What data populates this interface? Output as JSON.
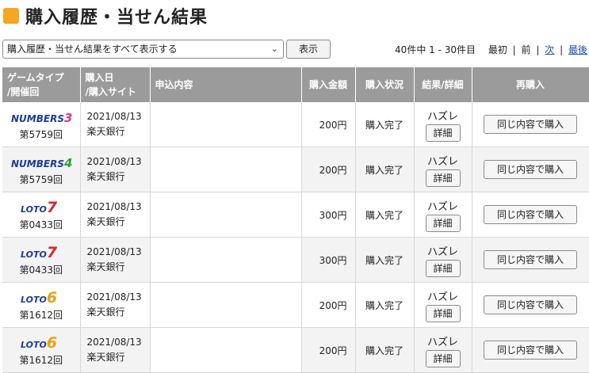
{
  "page": {
    "title": "購入履歴・当せん結果",
    "accent_color": "#f5a623"
  },
  "controls": {
    "filter_value": "購入履歴・当せん結果をすべて表示する",
    "show_label": "表示"
  },
  "pager": {
    "summary": "40件中 1 - 30件目",
    "first": "最初",
    "prev": "前",
    "next": "次",
    "last": "最後",
    "separator": "|"
  },
  "table": {
    "headers": {
      "game": "ゲームタイプ /開催回",
      "date": "購入日 /購入サイト",
      "content": "申込内容",
      "amount": "購入金額",
      "status": "購入状況",
      "result": "結果/詳細",
      "rebuy": "再購入"
    },
    "rows": [
      {
        "game": "NUMBERS3",
        "logo": "numbers3-logo",
        "round": "第5759回",
        "date": "2021/08/13",
        "site": "楽天銀行",
        "amount": "200円",
        "status": "購入完了",
        "result": "ハズレ",
        "detail": "詳細",
        "rebuy": "同じ内容で購入"
      },
      {
        "game": "NUMBERS4",
        "logo": "numbers4-logo",
        "round": "第5759回",
        "date": "2021/08/13",
        "site": "楽天銀行",
        "amount": "200円",
        "status": "購入完了",
        "result": "ハズレ",
        "detail": "詳細",
        "rebuy": "同じ内容で購入"
      },
      {
        "game": "LOTO7",
        "logo": "loto7-logo",
        "round": "第0433回",
        "date": "2021/08/13",
        "site": "楽天銀行",
        "amount": "300円",
        "status": "購入完了",
        "result": "ハズレ",
        "detail": "詳細",
        "rebuy": "同じ内容で購入"
      },
      {
        "game": "LOTO7",
        "logo": "loto7-logo",
        "round": "第0433回",
        "date": "2021/08/13",
        "site": "楽天銀行",
        "amount": "300円",
        "status": "購入完了",
        "result": "ハズレ",
        "detail": "詳細",
        "rebuy": "同じ内容で購入"
      },
      {
        "game": "LOTO6",
        "logo": "loto6-logo",
        "round": "第1612回",
        "date": "2021/08/13",
        "site": "楽天銀行",
        "amount": "200円",
        "status": "購入完了",
        "result": "ハズレ",
        "detail": "詳細",
        "rebuy": "同じ内容で購入"
      },
      {
        "game": "LOTO6",
        "logo": "loto6-logo",
        "round": "第1612回",
        "date": "2021/08/13",
        "site": "楽天銀行",
        "amount": "200円",
        "status": "購入完了",
        "result": "ハズレ",
        "detail": "詳細",
        "rebuy": "同じ内容で購入"
      }
    ]
  }
}
